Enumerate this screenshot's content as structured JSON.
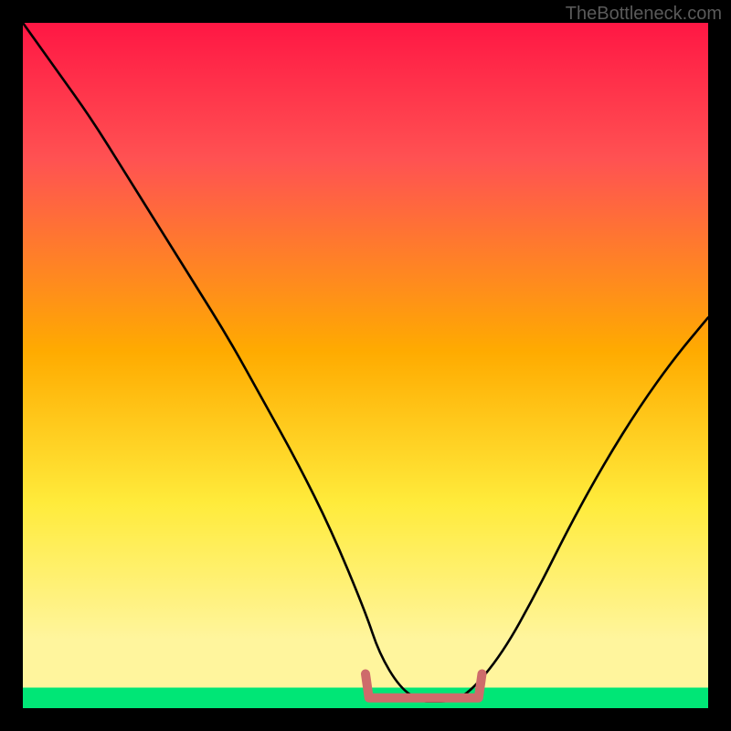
{
  "watermark": "TheBottleneck.com",
  "chart_data": {
    "type": "line",
    "title": "",
    "xlabel": "",
    "ylabel": "",
    "xlim": [
      0,
      100
    ],
    "ylim": [
      0,
      100
    ],
    "gradient": {
      "top": "#ff1744",
      "mid_upper": "#ff5252",
      "mid": "#ffab00",
      "mid_lower": "#ffeb3b",
      "low": "#fff59d",
      "bottom_strip": "#00e676"
    },
    "series": [
      {
        "name": "bottleneck-curve",
        "color": "#000000",
        "x": [
          0,
          5,
          10,
          15,
          20,
          25,
          30,
          35,
          40,
          45,
          50,
          52,
          55,
          58,
          60,
          62,
          65,
          70,
          75,
          80,
          85,
          90,
          95,
          100
        ],
        "y": [
          100,
          93,
          86,
          78,
          70,
          62,
          54,
          45,
          36,
          26,
          14,
          8,
          3,
          1,
          1,
          1,
          2,
          8,
          17,
          27,
          36,
          44,
          51,
          57
        ]
      },
      {
        "name": "optimal-band",
        "color": "#ce6b6b",
        "x": [
          50,
          52,
          55,
          58,
          60,
          62,
          65,
          67
        ],
        "y": [
          5,
          3,
          2,
          2,
          2,
          2,
          3,
          5
        ]
      }
    ],
    "optimal_shelf_y": 1.5,
    "green_strip": {
      "from_y": 0,
      "to_y": 3
    }
  }
}
